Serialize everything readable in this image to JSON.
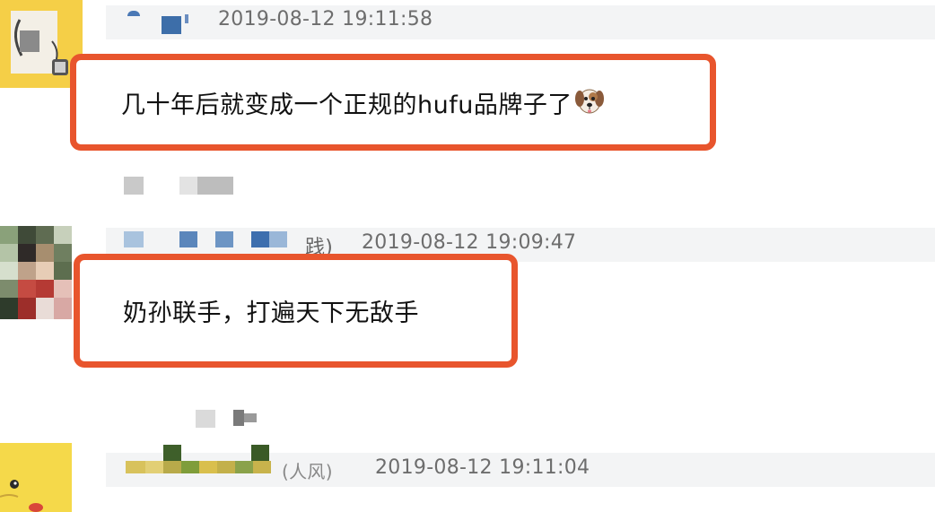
{
  "comments": [
    {
      "timestamp": "2019-08-12 19:11:58",
      "text": "几十年后就变成一个正规的hufu品牌子了",
      "emoji": "dog-face-icon"
    },
    {
      "timestamp": "2019-08-12 19:09:47",
      "name_fragment": "践)",
      "text": "奶孙联手，打遍天下无敌手"
    },
    {
      "timestamp": "2019-08-12 19:11:04",
      "name_fragment": "(人风)"
    }
  ],
  "colors": {
    "highlight_border": "#e8552d",
    "timestamp": "#6d6d6d",
    "band": "#f3f4f5"
  }
}
